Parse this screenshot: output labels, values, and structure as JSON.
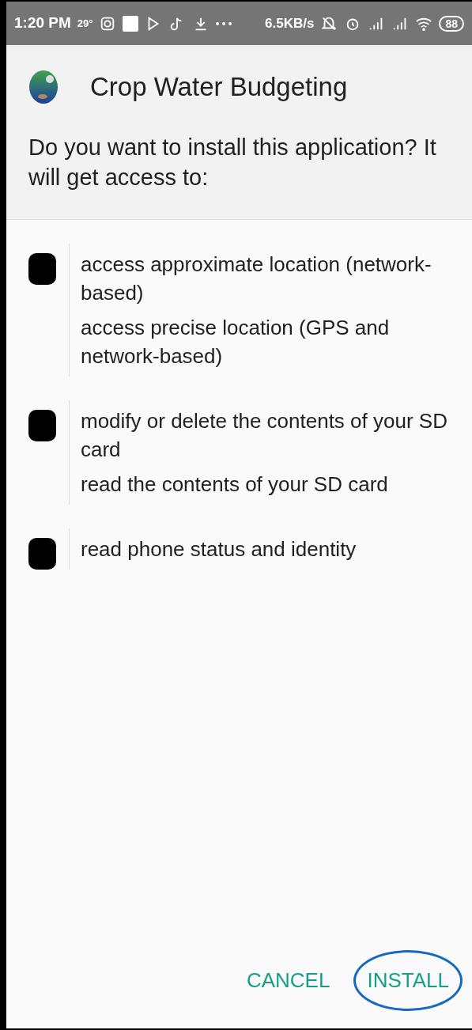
{
  "status_bar": {
    "time": "1:20 PM",
    "temperature": "29°",
    "speed": "6.5KB/s",
    "battery": "88"
  },
  "app": {
    "title": "Crop Water Budgeting"
  },
  "prompt": "Do you want to install this application? It will get access to:",
  "permission_groups": [
    {
      "items": [
        "access approximate location (network-based)",
        "access precise location (GPS and network-based)"
      ]
    },
    {
      "items": [
        "modify or delete the contents of your SD card",
        "read the contents of your SD card"
      ]
    },
    {
      "items": [
        "read phone status and identity"
      ]
    }
  ],
  "buttons": [
    {
      "label": "CANCEL",
      "highlighted": false
    },
    {
      "label": "INSTALL",
      "highlighted": true
    }
  ]
}
